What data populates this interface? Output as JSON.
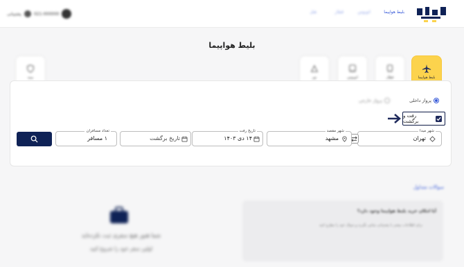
{
  "header": {
    "logo_text": "باطایاری",
    "nav": [
      "بلیط هواپیما",
      "اتوبوس",
      "قطار",
      "هتل"
    ],
    "phone_text": "021-000000",
    "support_text": "پشتیبانی"
  },
  "page_title": "بلیط هواپیما",
  "categories": [
    {
      "label": "بلیط هواپیما",
      "icon": "airplane-icon",
      "active": true
    },
    {
      "label": "قطار",
      "icon": "train-icon",
      "active": false
    },
    {
      "label": "اتوبوس",
      "icon": "bus-icon",
      "active": false
    },
    {
      "label": "تور",
      "icon": "tour-icon",
      "active": false
    },
    {
      "label": "بیمه",
      "icon": "insurance-icon",
      "active": false
    }
  ],
  "search": {
    "flight_types": [
      {
        "label": "پرواز داخلی",
        "selected": true
      },
      {
        "label": "پرواز خارجی",
        "selected": false
      }
    ],
    "round_trip_label": "رفت و برگشت",
    "round_trip_checked": true,
    "origin": {
      "label": "شهر مبدا",
      "value": "تهران"
    },
    "destination": {
      "label": "شهر مقصد",
      "value": "مشهد"
    },
    "depart_date": {
      "label": "تاریخ رفت",
      "value": "۱۴ دی ۱۴۰۳"
    },
    "return_date": {
      "placeholder": "تاریخ برگشت"
    },
    "passengers": {
      "label": "تعداد مسافران",
      "value": "۱ مسافر"
    }
  },
  "lower": {
    "section_title": "سوالات متداول",
    "info_title": "آیا امکان خرید بلیط هواپیما وجود دارد؟",
    "info_body": "برای اطلاعات بیشتر با پشتیبانی تماس بگیرید و سوال خود را مطرح کنید",
    "empty_line1": "شما هنوز هیچ سفری ثبت نکرده‌اید",
    "empty_line2": "اولین سفر خود را شروع کنید"
  },
  "colors": {
    "brand_blue": "#0f2256",
    "accent_yellow": "#fcd34d",
    "link_blue": "#3558d8"
  }
}
